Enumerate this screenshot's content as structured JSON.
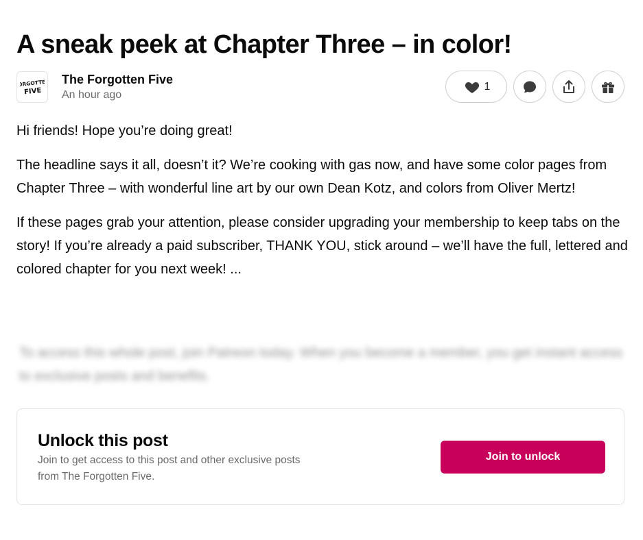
{
  "post": {
    "title": "A sneak peek at Chapter Three – in color!",
    "paragraphs": [
      "Hi friends! Hope you’re doing great!",
      "The headline says it all, doesn’t it? We’re cooking with gas now, and have some color pages from Chapter Three – with wonderful line art by our own Dean Kotz, and colors from Oliver Mertz!",
      "If these pages grab your attention, please consider upgrading your membership to keep tabs on the story! If you’re already a paid subscriber, THANK YOU, stick around – we’ll have the full, lettered and colored chapter for you next week! ..."
    ],
    "blurred_text": "To access this whole post, join Patreon today. When you become a member, you get instant access to exclusive posts and benefits."
  },
  "creator": {
    "name": "The Forgotten Five",
    "time": "An hour ago",
    "logo_text": [
      "FORGOTTEN",
      "FIVE"
    ]
  },
  "actions": {
    "like_count": "1",
    "like_icon": "heart-icon",
    "comment_icon": "comment-icon",
    "share_icon": "share-icon",
    "gift_icon": "gift-icon"
  },
  "unlock": {
    "title": "Unlock this post",
    "description": "Join to get access to this post and other exclusive posts from The Forgotten Five.",
    "button_label": "Join to unlock"
  },
  "colors": {
    "accent": "#c8005b",
    "text": "#0b0b0b",
    "muted": "#6b6b6b",
    "border": "#e4e4e4"
  }
}
